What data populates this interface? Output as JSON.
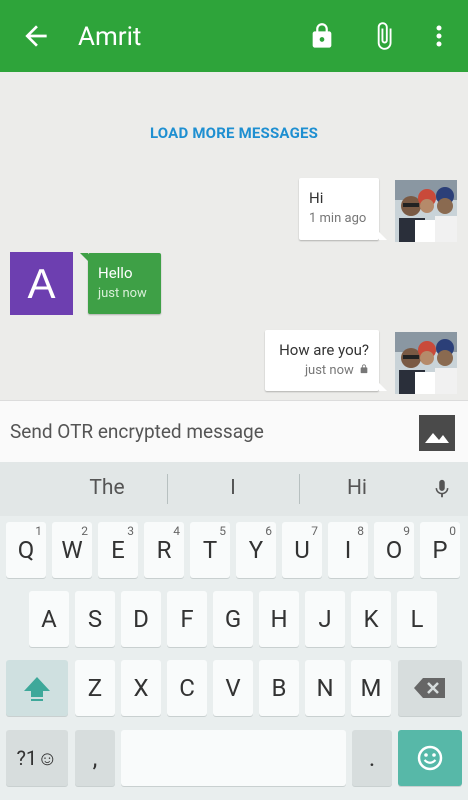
{
  "header": {
    "title": "Amrit"
  },
  "chat": {
    "load_more": "LOAD MORE MESSAGES",
    "avatar_letter": "A",
    "messages": [
      {
        "text": "Hi",
        "time": "1 min ago",
        "direction": "out"
      },
      {
        "text": "Hello",
        "time": "just now",
        "direction": "in"
      },
      {
        "text": "How are you?",
        "time": "just now",
        "direction": "out"
      }
    ]
  },
  "compose": {
    "placeholder": "Send OTR encrypted message"
  },
  "keyboard": {
    "suggestions": [
      "The",
      "I",
      "Hi"
    ],
    "row1": [
      {
        "k": "Q",
        "h": "1"
      },
      {
        "k": "W",
        "h": "2"
      },
      {
        "k": "E",
        "h": "3"
      },
      {
        "k": "R",
        "h": "4"
      },
      {
        "k": "T",
        "h": "5"
      },
      {
        "k": "Y",
        "h": "6"
      },
      {
        "k": "U",
        "h": "7"
      },
      {
        "k": "I",
        "h": "8"
      },
      {
        "k": "O",
        "h": "9"
      },
      {
        "k": "P",
        "h": "0"
      }
    ],
    "row2": [
      "A",
      "S",
      "D",
      "F",
      "G",
      "H",
      "J",
      "K",
      "L"
    ],
    "row3": [
      "Z",
      "X",
      "C",
      "V",
      "B",
      "N",
      "M"
    ],
    "symbols_label": "?1☺",
    "comma": ",",
    "period": "."
  },
  "colors": {
    "appbar": "#2ea43a",
    "incoming": "#3ea046",
    "link": "#1e8fd1",
    "avatar": "#6d3fb0",
    "action_key": "#57b8a8"
  }
}
